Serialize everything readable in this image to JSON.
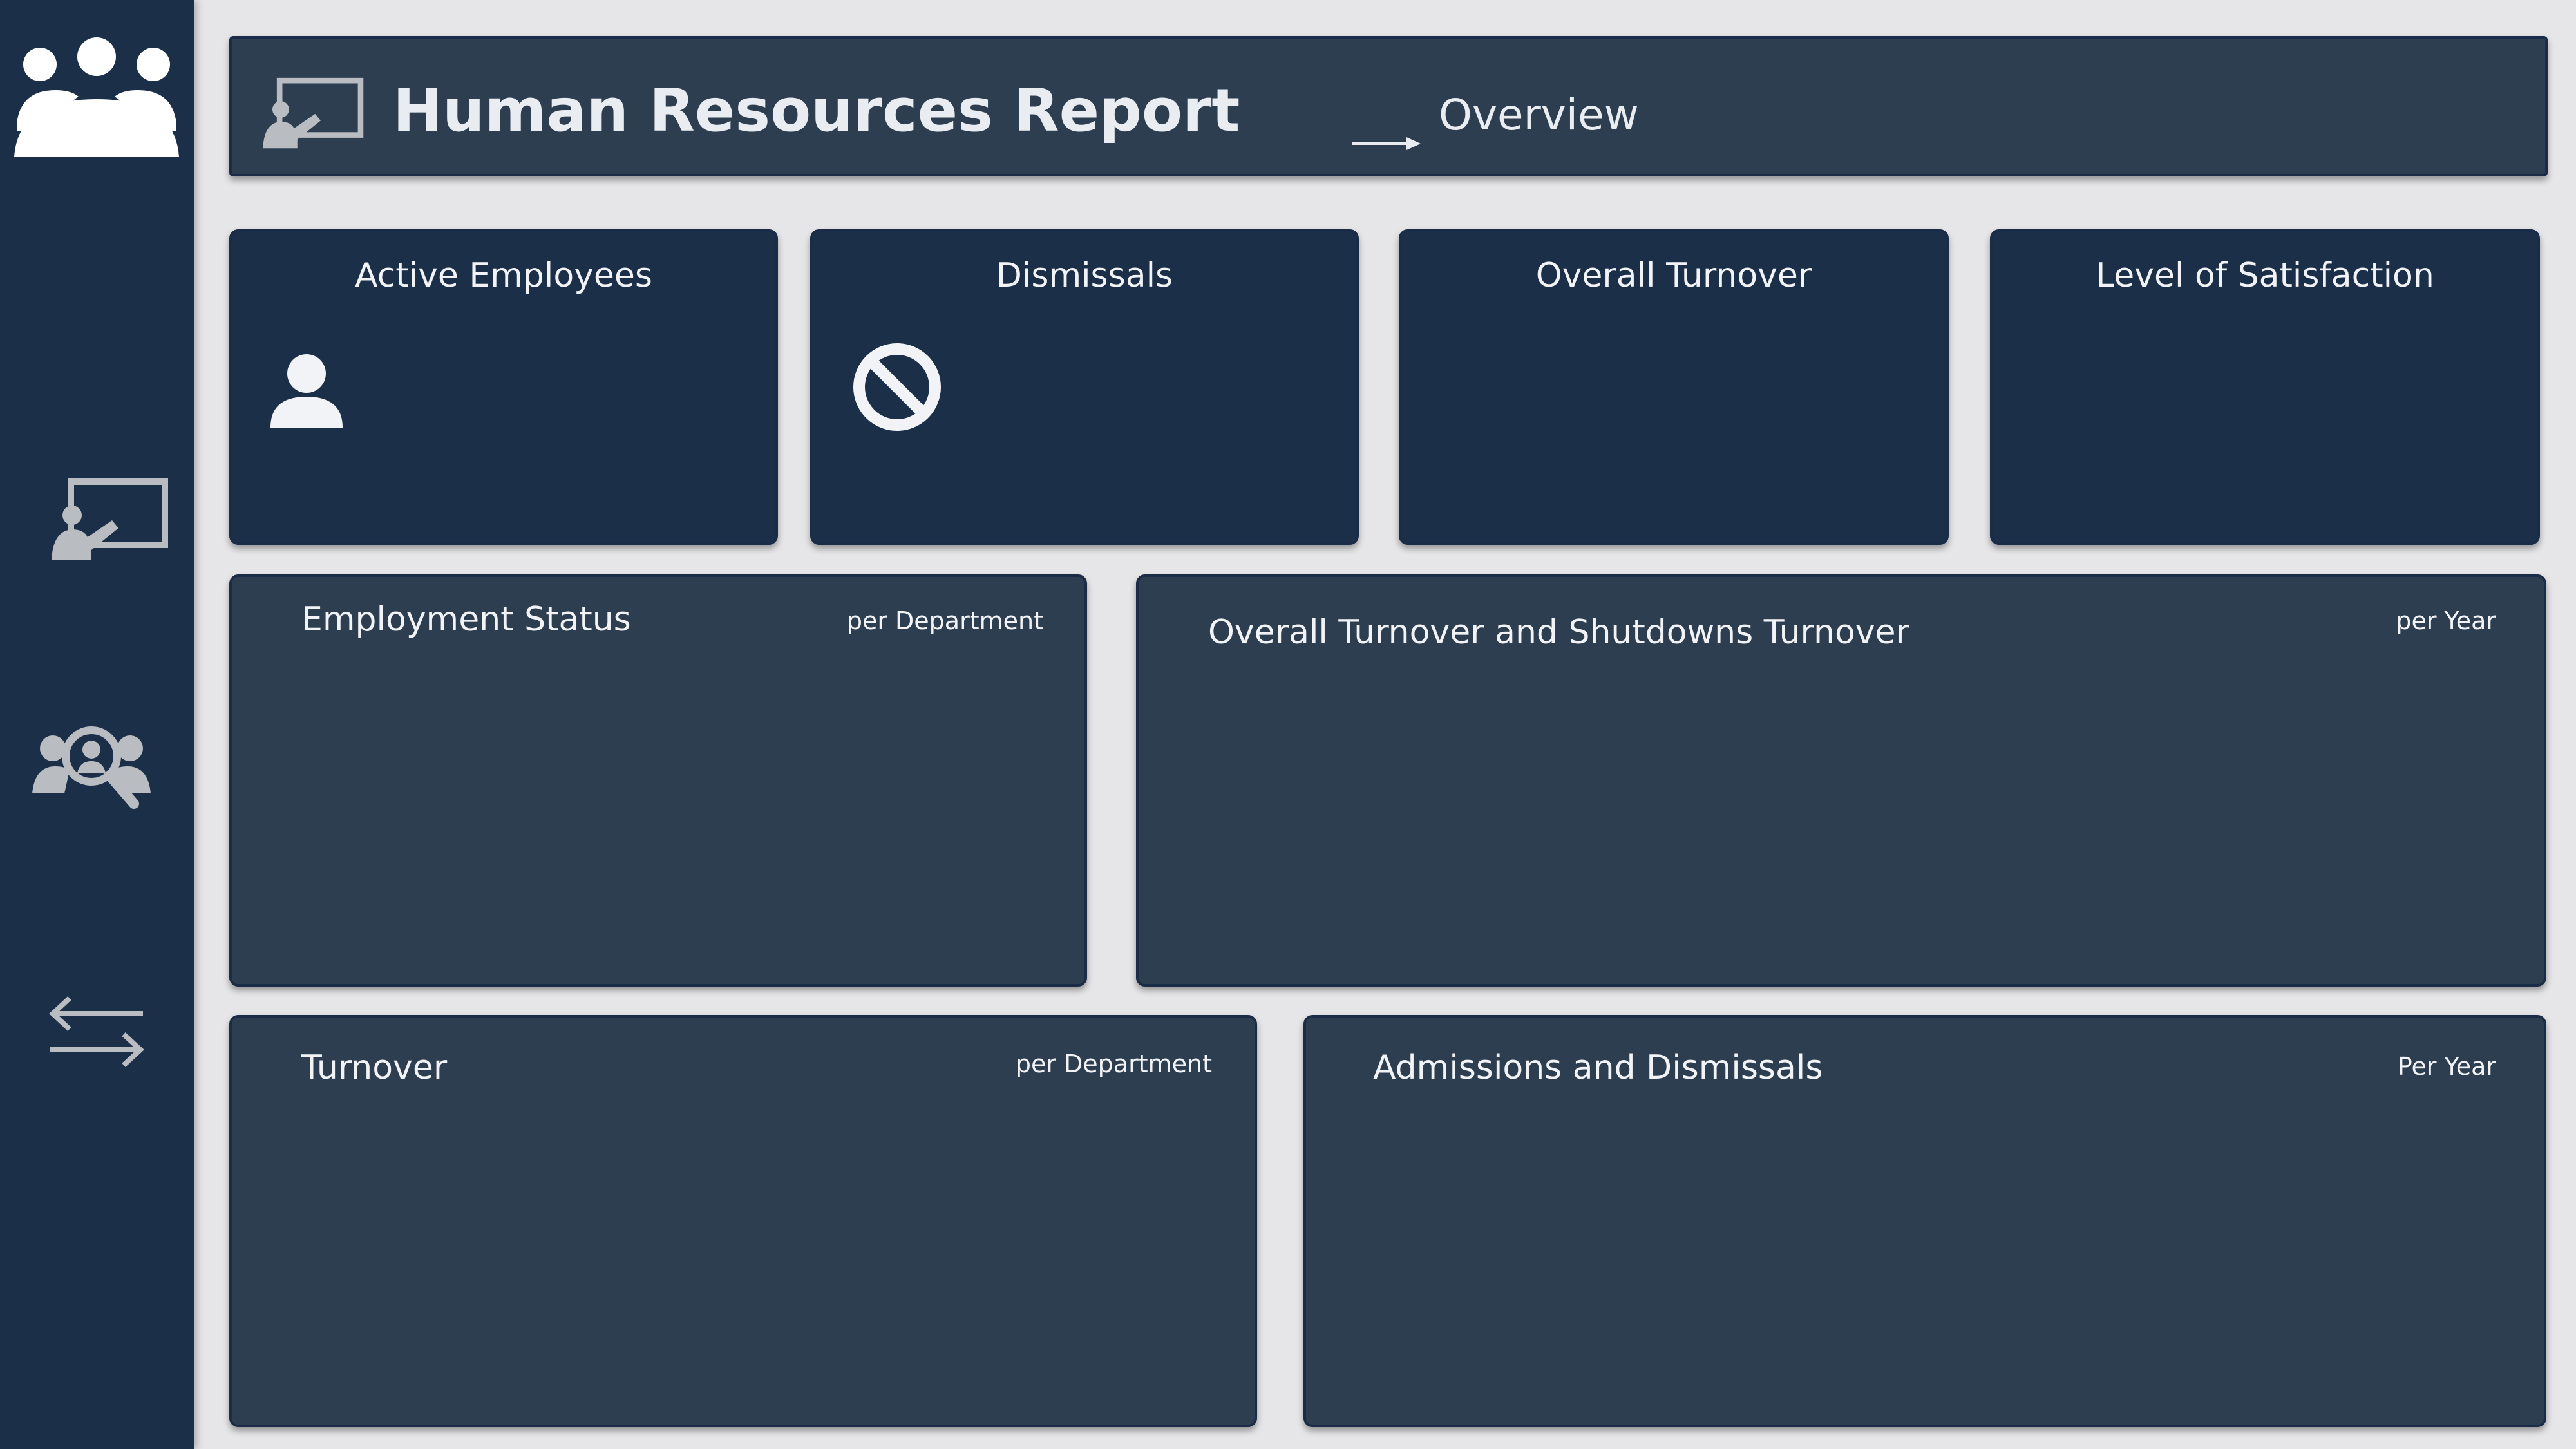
{
  "sidebar": {
    "icons": [
      "team-icon",
      "presentation-icon",
      "people-search-icon",
      "switch-arrows-icon"
    ]
  },
  "header": {
    "icon": "presentation-icon",
    "title": "Human Resources Report",
    "arrow_icon": "arrow-right-icon",
    "subtitle": "Overview"
  },
  "kpis": [
    {
      "title": "Active Employees",
      "icon": "person-icon"
    },
    {
      "title": "Dismissals",
      "icon": "prohibited-icon"
    },
    {
      "title": "Overall Turnover"
    },
    {
      "title": "Level of Satisfaction"
    }
  ],
  "cards": {
    "employment_status": {
      "title": "Employment Status",
      "subtitle": "per Department"
    },
    "turnover_shutdowns": {
      "title": "Overall Turnover and Shutdowns Turnover",
      "subtitle": "per Year"
    },
    "turnover": {
      "title": "Turnover",
      "subtitle": "per Department"
    },
    "admissions_dismissals": {
      "title": "Admissions and Dismissals",
      "subtitle": "Per Year"
    }
  },
  "colors": {
    "background": "#e6e6e8",
    "sidebar": "#1b2f48",
    "kpi_card": "#1b2f48",
    "chart_card": "#2e3e51",
    "text": "#f1f3f6",
    "icon_grey": "#b9bcc1"
  }
}
